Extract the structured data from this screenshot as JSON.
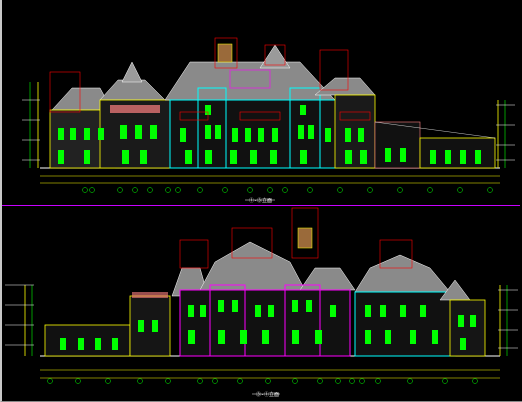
{
  "window": {
    "width_label": "",
    "title": ""
  },
  "drawings": [
    {
      "id": "elevation-1",
      "label": "①-③立面"
    },
    {
      "id": "elevation-2",
      "label": "③-①立面"
    }
  ],
  "colors": {
    "background": "#000000",
    "roof": "#8a8a8a",
    "green": "#00ff00",
    "yellow": "#ffff00",
    "cyan": "#00ffff",
    "red": "#ff0000",
    "magenta": "#ff00ff",
    "white": "#ffffff",
    "divider": "#c800ff"
  }
}
